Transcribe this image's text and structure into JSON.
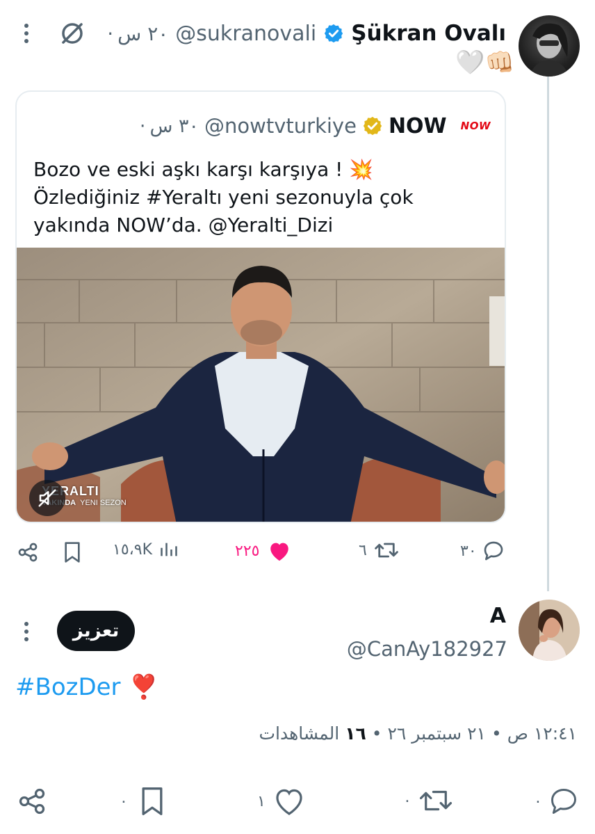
{
  "main_tweet": {
    "display_name": "Şükran Ovalı",
    "handle": "@sukranovali",
    "time": "٢٠ س",
    "separator": "·",
    "emoji_line": "🤍👊🏻"
  },
  "quoted_tweet": {
    "display_name": "NOW",
    "brand_badge": "NOW",
    "handle": "@nowtvturkiye",
    "time": "٣٠ س",
    "separator": "·",
    "text_line1": "Bozo ve eski aşkı karşı karşıya ! 💥",
    "text_line2": "Özlediğiniz #Yeraltı yeni sezonuyla çok",
    "text_line3": "yakında NOW’da. @Yeralti_Dizi",
    "video_overlay": {
      "title": "YERALTI",
      "subtitle_left": "YAKINDA",
      "subtitle_right": "YENI SEZON"
    }
  },
  "main_actions": {
    "views": "١٥،٩K",
    "likes": "٢٢٥",
    "retweets": "٦",
    "replies": "٣٠",
    "liked_color": "#f91880"
  },
  "reply": {
    "display_name": "A",
    "handle": "@CanAy182927",
    "promote_label": "تعزيز",
    "text_hashtag": "#BozDer",
    "text_emoji": "❣️",
    "meta_time": "١٢:٤١ ص",
    "meta_date": "٢١ سبتمبر ٢٦",
    "meta_views_count": "١٦",
    "meta_views_label": "المشاهدات",
    "meta_separator": "•"
  },
  "reply_actions": {
    "bookmarks": "٠",
    "likes": "١",
    "retweets": "٠",
    "replies": "٠"
  },
  "colors": {
    "accent_blue": "#1d9bf0",
    "gold_badge": "#e2b719",
    "like_pink": "#f91880",
    "muted": "#536471",
    "brand_red": "#e30613"
  }
}
